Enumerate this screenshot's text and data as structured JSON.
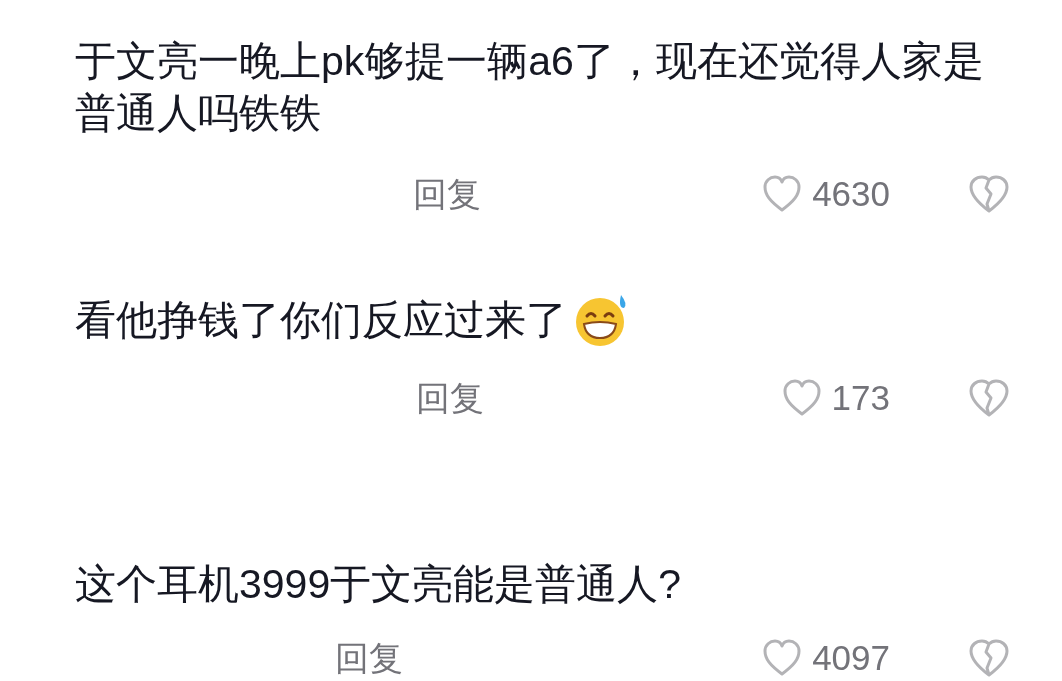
{
  "comments": [
    {
      "text": "于文亮一晚上pk够提一辆a6了，现在还觉得人家是普通人吗铁铁",
      "emoji": false,
      "reply": "回复",
      "likes": "4630"
    },
    {
      "text": "看他挣钱了你们反应过来了",
      "emoji": true,
      "reply": "回复",
      "likes": "173"
    },
    {
      "text": "这个耳机3999于文亮能是普通人?",
      "emoji": false,
      "reply": "回复",
      "likes": "4097"
    }
  ]
}
